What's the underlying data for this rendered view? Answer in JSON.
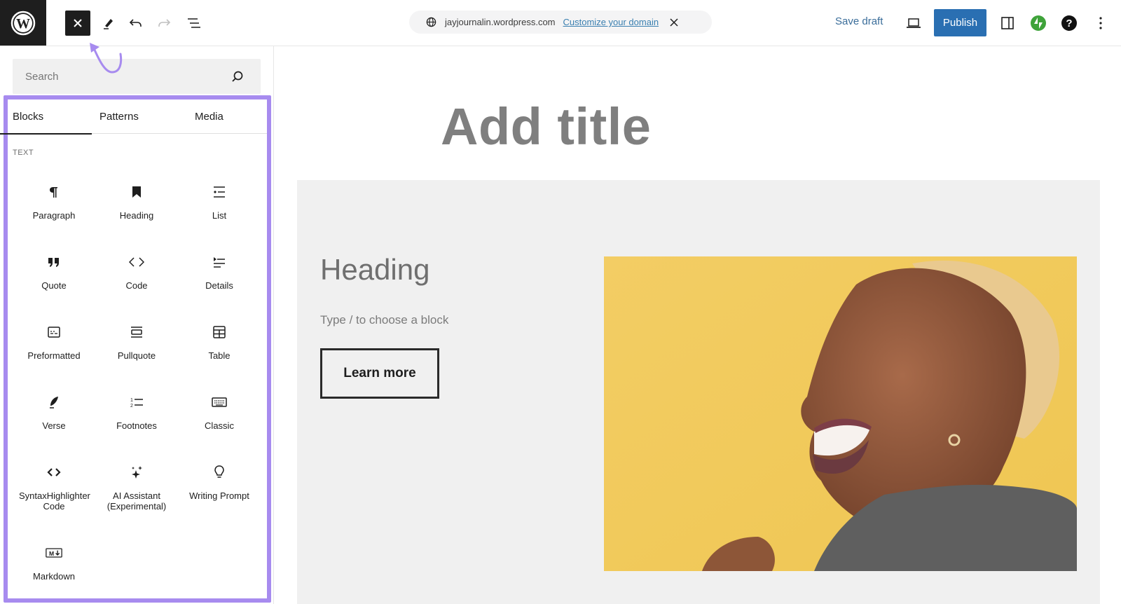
{
  "topbar": {
    "close_label": "Close block inserter",
    "domain": "jayjournalin.wordpress.com",
    "customize_domain": "Customize your domain",
    "save_draft": "Save draft",
    "publish": "Publish"
  },
  "sidebar": {
    "search_placeholder": "Search",
    "tabs": [
      {
        "label": "Blocks",
        "active": true
      },
      {
        "label": "Patterns",
        "active": false
      },
      {
        "label": "Media",
        "active": false
      }
    ],
    "section_label": "TEXT",
    "blocks": [
      {
        "label": "Paragraph",
        "icon": "paragraph-icon"
      },
      {
        "label": "Heading",
        "icon": "bookmark-icon"
      },
      {
        "label": "List",
        "icon": "list-icon"
      },
      {
        "label": "Quote",
        "icon": "quote-icon"
      },
      {
        "label": "Code",
        "icon": "code-icon"
      },
      {
        "label": "Details",
        "icon": "details-icon"
      },
      {
        "label": "Preformatted",
        "icon": "preformatted-icon"
      },
      {
        "label": "Pullquote",
        "icon": "pullquote-icon"
      },
      {
        "label": "Table",
        "icon": "table-icon"
      },
      {
        "label": "Verse",
        "icon": "quill-icon"
      },
      {
        "label": "Footnotes",
        "icon": "footnotes-icon"
      },
      {
        "label": "Classic",
        "icon": "keyboard-icon"
      },
      {
        "label": "SyntaxHighlighter Code",
        "icon": "syntax-code-icon"
      },
      {
        "label": "AI Assistant (Experimental)",
        "icon": "sparkles-icon"
      },
      {
        "label": "Writing Prompt",
        "icon": "lightbulb-icon"
      },
      {
        "label": "Markdown",
        "icon": "markdown-icon"
      }
    ]
  },
  "canvas": {
    "title_placeholder": "Add title",
    "cover_heading": "Heading",
    "cover_placeholder": "Type / to choose a block",
    "button_label": "Learn more"
  },
  "colors": {
    "accent_highlight": "#a78bef",
    "publish_blue": "#2a6fb2",
    "jetpack_green": "#3fa33a"
  }
}
